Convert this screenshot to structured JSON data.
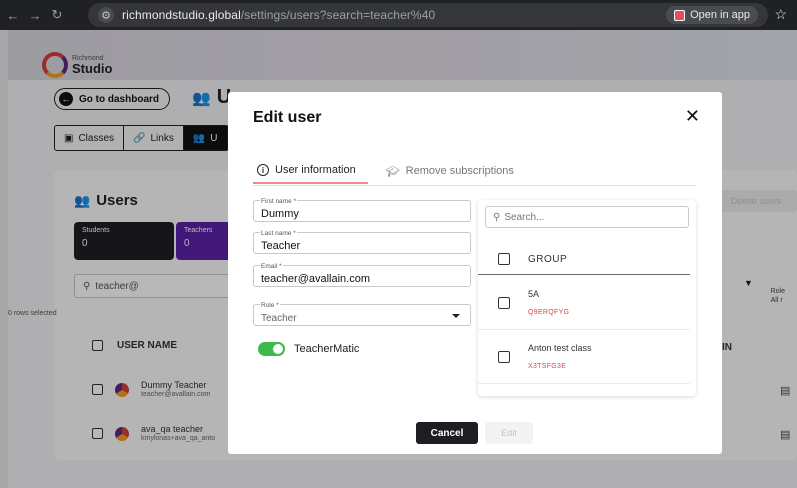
{
  "browser": {
    "url_host": "richmondstudio.global",
    "url_path": "/settings/users?search=teacher%40",
    "open_in_app": "Open in app"
  },
  "app": {
    "logo_small": "Richmond",
    "logo_big": "Studio",
    "go_to_dashboard": "Go to dashboard",
    "page_title_fragment": "U",
    "tabs": [
      "Classes",
      "Links",
      "U"
    ],
    "users_title": "Users",
    "stats": [
      {
        "label": "Students",
        "value": "0"
      },
      {
        "label": "Teachers",
        "value": "0"
      }
    ],
    "delete_users": "Delete users",
    "search_value": "teacher@",
    "rows_selected": "0 rows selected",
    "col_user_name": "USER NAME",
    "col_in": "IN",
    "role_label": "Role",
    "role_value": "All r",
    "rows": [
      {
        "name": "Dummy Teacher",
        "email": "teacher@avallain.com"
      },
      {
        "name": "ava_qa teacher",
        "email": "kmylonas+ava_qa_anto"
      }
    ]
  },
  "modal": {
    "title": "Edit user",
    "tabs": {
      "user_information": "User information",
      "remove_subscriptions": "Remove subscriptions"
    },
    "fields": {
      "first_name": {
        "label": "First name *",
        "value": "Dummy"
      },
      "last_name": {
        "label": "Last name *",
        "value": "Teacher"
      },
      "email": {
        "label": "Email *",
        "value": "teacher@avallain.com"
      },
      "role": {
        "label": "Role *",
        "value": "Teacher"
      }
    },
    "toggle_label": "TeacherMatic",
    "toggle_on": true,
    "group_search_placeholder": "Search...",
    "group_header": "GROUP",
    "groups": [
      {
        "name": "5A",
        "code": "Q9ERQFYG"
      },
      {
        "name": "Anton test class",
        "code": "X3TSFG3E"
      }
    ],
    "cancel_label": "Cancel",
    "edit_label": "Edit"
  },
  "colors": {
    "accent_red": "#d4494b",
    "toggle_green": "#3cb94a",
    "teachers_purple": "#5b20a8"
  }
}
